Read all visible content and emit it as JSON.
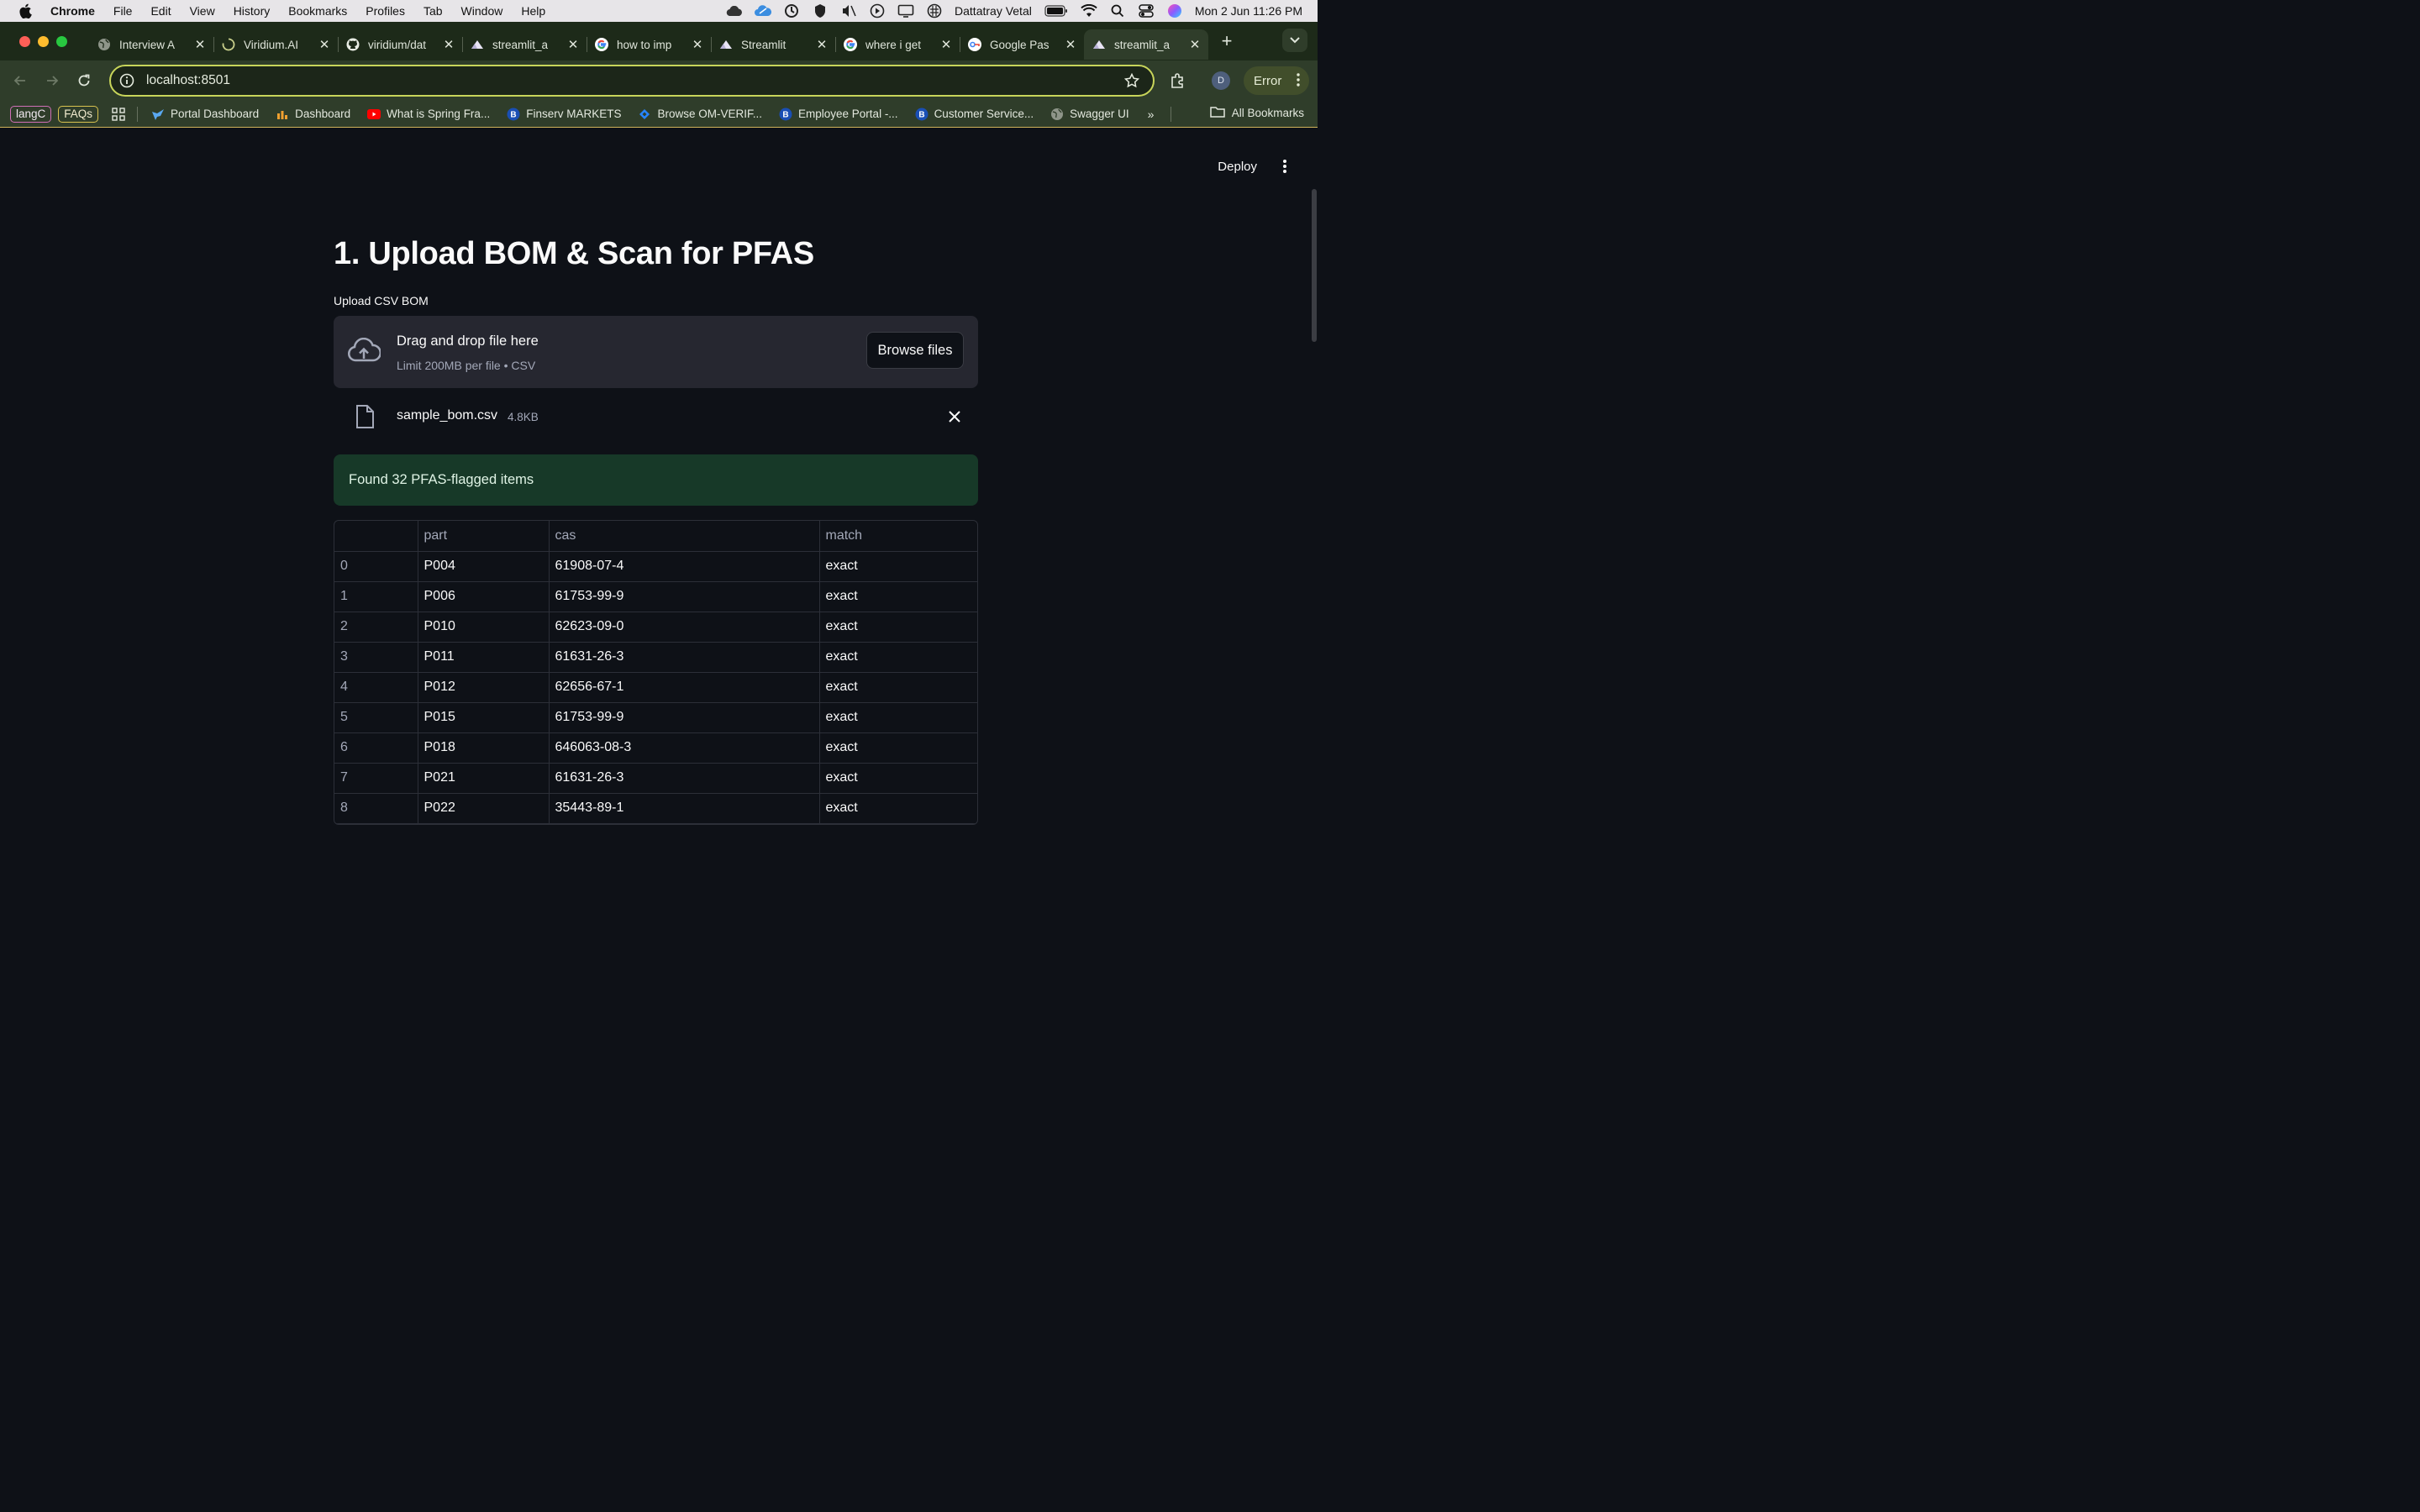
{
  "mac_menubar": {
    "app_name": "Chrome",
    "menus": [
      "File",
      "Edit",
      "View",
      "History",
      "Bookmarks",
      "Profiles",
      "Tab",
      "Window",
      "Help"
    ],
    "user_name": "Dattatray Vetal",
    "clock": "Mon 2 Jun  11:26 PM"
  },
  "tabs": [
    {
      "title": "Interview A",
      "icon": "globe-icon",
      "active": false
    },
    {
      "title": "Viridium.AI",
      "icon": "loading-spinner-icon",
      "active": false
    },
    {
      "title": "viridium/dat",
      "icon": "github-icon",
      "active": false
    },
    {
      "title": "streamlit_a",
      "icon": "streamlit-icon",
      "active": false
    },
    {
      "title": "how to imp",
      "icon": "google-icon",
      "active": false
    },
    {
      "title": "Streamlit",
      "icon": "streamlit-icon",
      "active": false
    },
    {
      "title": "where i get",
      "icon": "google-icon",
      "active": false
    },
    {
      "title": "Google Pas",
      "icon": "google-passwords-icon",
      "active": false
    },
    {
      "title": "streamlit_a",
      "icon": "streamlit-icon",
      "active": true
    }
  ],
  "toolbar": {
    "url": "localhost:8501",
    "profile_initial": "D",
    "error_label": "Error"
  },
  "bookmarks": {
    "chips": [
      "langC",
      "FAQs"
    ],
    "items": [
      {
        "label": "Portal Dashboard",
        "icon": "bird-icon"
      },
      {
        "label": "Dashboard",
        "icon": "bars-icon"
      },
      {
        "label": "What is Spring Fra...",
        "icon": "youtube-icon"
      },
      {
        "label": "Finserv MARKETS",
        "icon": "bajaj-icon"
      },
      {
        "label": "Browse OM-VERIF...",
        "icon": "jira-icon"
      },
      {
        "label": "Employee Portal -...",
        "icon": "bajaj-icon"
      },
      {
        "label": "Customer Service...",
        "icon": "bajaj-icon"
      },
      {
        "label": "Swagger UI",
        "icon": "globe-icon"
      }
    ],
    "more": "»",
    "all_bookmarks": "All Bookmarks"
  },
  "app": {
    "deploy_label": "Deploy",
    "title": "1. Upload BOM & Scan for PFAS",
    "uploader": {
      "label": "Upload CSV BOM",
      "drag_text": "Drag and drop file here",
      "limit_text": "Limit 200MB per file • CSV",
      "browse_label": "Browse files",
      "file_name": "sample_bom.csv",
      "file_size": "4.8KB"
    },
    "success_message": "Found 32 PFAS-flagged items",
    "table": {
      "columns": [
        "",
        "part",
        "cas",
        "match"
      ],
      "rows": [
        [
          "0",
          "P004",
          "61908-07-4",
          "exact"
        ],
        [
          "1",
          "P006",
          "61753-99-9",
          "exact"
        ],
        [
          "2",
          "P010",
          "62623-09-0",
          "exact"
        ],
        [
          "3",
          "P011",
          "61631-26-3",
          "exact"
        ],
        [
          "4",
          "P012",
          "62656-67-1",
          "exact"
        ],
        [
          "5",
          "P015",
          "61753-99-9",
          "exact"
        ],
        [
          "6",
          "P018",
          "646063-08-3",
          "exact"
        ],
        [
          "7",
          "P021",
          "61631-26-3",
          "exact"
        ],
        [
          "8",
          "P022",
          "35443-89-1",
          "exact"
        ]
      ]
    }
  },
  "colors": {
    "page_bg": "#0e1117",
    "chrome_frame": "#1d2a19",
    "chrome_toolbar": "#2f3d2a",
    "success_bg": "#173928",
    "uploader_bg": "#262730"
  }
}
